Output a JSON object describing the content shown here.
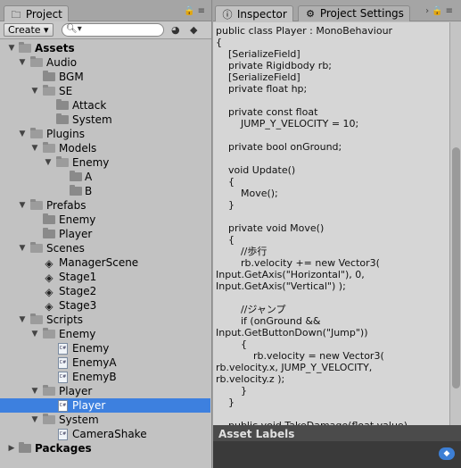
{
  "project_tab": {
    "label": "Project",
    "icon": "folder-icon"
  },
  "toolbar": {
    "create_label": "Create ▾",
    "search_placeholder": ""
  },
  "tree": {
    "assets": "Assets",
    "audio": "Audio",
    "bgm": "BGM",
    "se": "SE",
    "attack": "Attack",
    "system": "System",
    "plugins": "Plugins",
    "models": "Models",
    "enemy_models": "Enemy",
    "a": "A",
    "b": "B",
    "prefabs": "Prefabs",
    "enemy_prefab": "Enemy",
    "player_prefab": "Player",
    "scenes": "Scenes",
    "manager_scene": "ManagerScene",
    "stage1": "Stage1",
    "stage2": "Stage2",
    "stage3": "Stage3",
    "scripts": "Scripts",
    "enemy_scripts": "Enemy",
    "enemy_cs": "Enemy",
    "enemy_a_cs": "EnemyA",
    "enemy_b_cs": "EnemyB",
    "player_scripts": "Player",
    "player_cs": "Player",
    "system_scripts": "System",
    "camera_shake_cs": "CameraShake",
    "packages": "Packages"
  },
  "inspector_tab": {
    "label": "Inspector",
    "icon": "info-icon"
  },
  "project_settings_tab": {
    "label": "Project Settings",
    "icon": "gear-icon"
  },
  "code": {
    "text": "public class Player : MonoBehaviour\n{\n    [SerializeField]\n    private Rigidbody rb;\n    [SerializeField]\n    private float hp;\n\n    private const float\n        JUMP_Y_VELOCITY = 10;\n\n    private bool onGround;\n\n    void Update()\n    {\n        Move();\n    }\n\n    private void Move()\n    {\n        //歩行\n        rb.velocity += new Vector3(\nInput.GetAxis(\"Horizontal\"), 0,\nInput.GetAxis(\"Vertical\") );\n\n        //ジャンプ\n        if (onGround &&\nInput.GetButtonDown(\"Jump\"))\n        {\n            rb.velocity = new Vector3(\nrb.velocity.x, JUMP_Y_VELOCITY,\nrb.velocity.z );\n        }\n    }\n\n    public void TakeDamage(float value)"
  },
  "asset_labels": {
    "title": "Asset Labels"
  }
}
